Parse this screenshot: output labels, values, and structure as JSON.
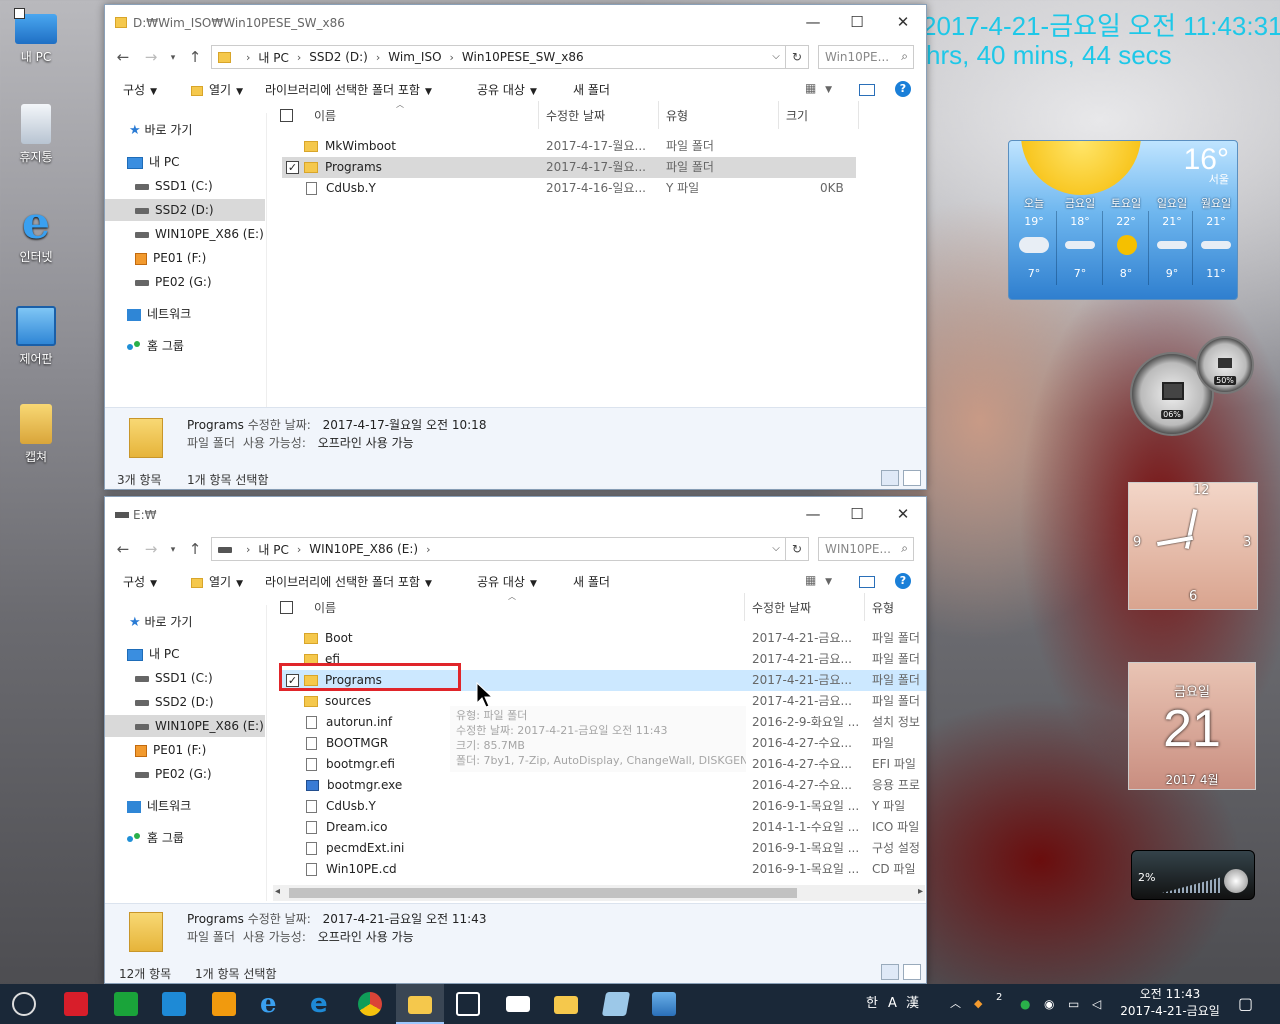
{
  "desktop": {
    "icons": [
      {
        "label": "내 PC"
      },
      {
        "label": "휴지통"
      },
      {
        "label": "인터넷"
      },
      {
        "label": "제어판"
      },
      {
        "label": "캡쳐"
      }
    ],
    "clock_line1": "2017-4-21-금요일 오전 11:43:31",
    "clock_line2": "hrs, 40 mins, 44 secs"
  },
  "window1": {
    "title": "D:₩Wim_ISO₩Win10PESE_SW_x86",
    "address": [
      "내 PC",
      "SSD2 (D:)",
      "Wim_ISO",
      "Win10PESE_SW_x86"
    ],
    "search_placeholder": "Win10PE...",
    "toolbar": {
      "organize": "구성",
      "open": "열기",
      "include_library": "라이브러리에 선택한 폴더 포함",
      "share": "공유 대상",
      "new_folder": "새 폴더"
    },
    "nav": {
      "quick_access": "바로 가기",
      "this_pc": "내 PC",
      "drives": [
        "SSD1 (C:)",
        "SSD2 (D:)",
        "WIN10PE_X86 (E:)",
        "PE01 (F:)",
        "PE02 (G:)"
      ],
      "network": "네트워크",
      "homegroup": "홈 그룹"
    },
    "columns": [
      "이름",
      "수정한 날짜",
      "유형",
      "크기"
    ],
    "rows": [
      {
        "name": "MkWimboot",
        "date": "2017-4-17-월요...",
        "type": "파일 폴더",
        "size": "",
        "kind": "folder"
      },
      {
        "name": "Programs",
        "date": "2017-4-17-월요...",
        "type": "파일 폴더",
        "size": "",
        "kind": "folder"
      },
      {
        "name": "CdUsb.Y",
        "date": "2017-4-16-일요...",
        "type": "Y 파일",
        "size": "0KB",
        "kind": "file"
      }
    ],
    "details": {
      "name": "Programs",
      "modified_label": "수정한 날짜:",
      "modified_value": "2017-4-17-월요일 오전 10:18",
      "type": "파일 폴더",
      "avail_label": "사용 가능성:",
      "avail_value": "오프라인 사용 가능"
    },
    "status": {
      "items": "3개 항목",
      "selected": "1개 항목 선택함"
    }
  },
  "window2": {
    "title": "E:₩",
    "address": [
      "내 PC",
      "WIN10PE_X86 (E:)"
    ],
    "search_placeholder": "WIN10PE...",
    "toolbar": {
      "organize": "구성",
      "open": "열기",
      "include_library": "라이브러리에 선택한 폴더 포함",
      "share": "공유 대상",
      "new_folder": "새 폴더"
    },
    "nav": {
      "quick_access": "바로 가기",
      "this_pc": "내 PC",
      "drives": [
        "SSD1 (C:)",
        "SSD2 (D:)",
        "WIN10PE_X86 (E:)",
        "PE01 (F:)",
        "PE02 (G:)"
      ],
      "network": "네트워크",
      "homegroup": "홈 그룹"
    },
    "columns": [
      "이름",
      "수정한 날짜",
      "유형"
    ],
    "rows": [
      {
        "name": "Boot",
        "date": "2017-4-21-금요...",
        "type": "파일 폴더",
        "kind": "folder"
      },
      {
        "name": "efi",
        "date": "2017-4-21-금요...",
        "type": "파일 폴더",
        "kind": "folder"
      },
      {
        "name": "Programs",
        "date": "2017-4-21-금요...",
        "type": "파일 폴더",
        "kind": "folder"
      },
      {
        "name": "sources",
        "date": "2017-4-21-금요...",
        "type": "파일 폴더",
        "kind": "folder"
      },
      {
        "name": "autorun.inf",
        "date": "2016-2-9-화요일 ...",
        "type": "설치 정보",
        "kind": "file"
      },
      {
        "name": "BOOTMGR",
        "date": "2016-4-27-수요...",
        "type": "파일",
        "kind": "file"
      },
      {
        "name": "bootmgr.efi",
        "date": "2016-4-27-수요...",
        "type": "EFI 파일",
        "kind": "file"
      },
      {
        "name": "bootmgr.exe",
        "date": "2016-4-27-수요...",
        "type": "응용 프로",
        "kind": "exe"
      },
      {
        "name": "CdUsb.Y",
        "date": "2016-9-1-목요일 ...",
        "type": "Y 파일",
        "kind": "file"
      },
      {
        "name": "Dream.ico",
        "date": "2014-1-1-수요일 ...",
        "type": "ICO 파일",
        "kind": "file"
      },
      {
        "name": "pecmdExt.ini",
        "date": "2016-9-1-목요일 ...",
        "type": "구성 설정",
        "kind": "file"
      },
      {
        "name": "Win10PE.cd",
        "date": "2016-9-1-목요일 ...",
        "type": "CD 파일",
        "kind": "file"
      }
    ],
    "tooltip": [
      "유형: 파일 폴더",
      "수정한 날짜: 2017-4-21-금요일 오전 11:43",
      "크기: 85.7MB",
      "폴더: 7by1, 7-Zip, AutoDisplay, ChangeWall, DISKGEN..."
    ],
    "details": {
      "name": "Programs",
      "modified_label": "수정한 날짜:",
      "modified_value": "2017-4-21-금요일 오전 11:43",
      "type": "파일 폴더",
      "avail_label": "사용 가능성:",
      "avail_value": "오프라인 사용 가능"
    },
    "status": {
      "items": "12개 항목",
      "selected": "1개 항목 선택함"
    }
  },
  "weather": {
    "temp": "16°",
    "city": "서울",
    "days": [
      {
        "day": "오늘",
        "hi": "19°",
        "lo": "7°"
      },
      {
        "day": "금요일",
        "hi": "18°",
        "lo": "7°"
      },
      {
        "day": "토요일",
        "hi": "22°",
        "lo": "8°"
      },
      {
        "day": "일요일",
        "hi": "21°",
        "lo": "9°"
      },
      {
        "day": "월요일",
        "hi": "21°",
        "lo": "11°"
      }
    ]
  },
  "gauges": {
    "cpu": "06%",
    "mem": "50%"
  },
  "clock_gadget": {
    "n12": "12",
    "n3": "3",
    "n6": "6",
    "n9": "9"
  },
  "calendar_gadget": {
    "weekday": "금요일",
    "day": "21",
    "month": "2017 4월"
  },
  "volume_gadget": {
    "level": "2%"
  },
  "taskbar": {
    "ime1": "한",
    "ime2": "A",
    "ime3": "漢",
    "time": "오전 11:43",
    "date": "2017-4-21-금요일",
    "tray_badge": "2"
  }
}
